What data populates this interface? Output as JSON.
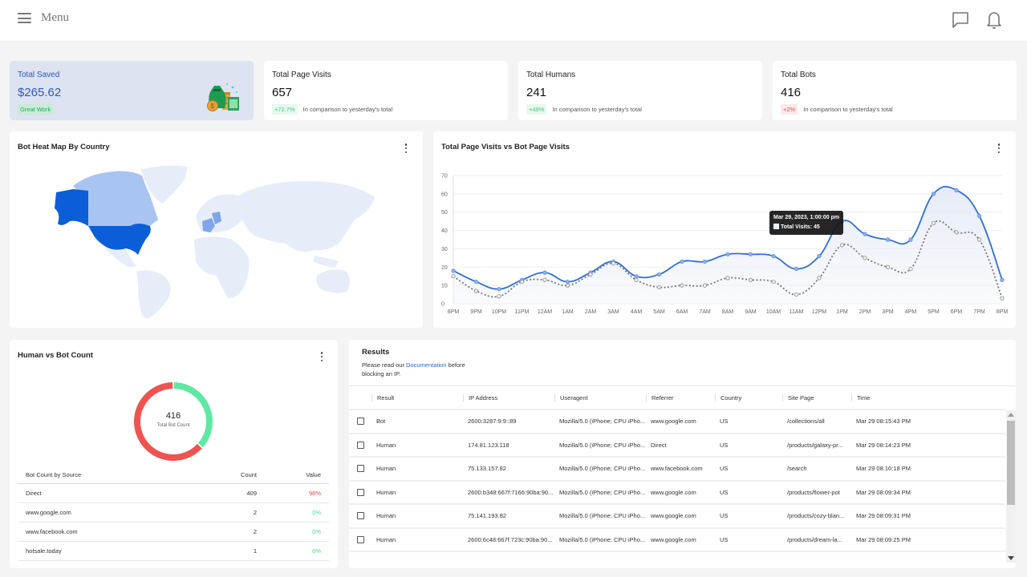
{
  "topbar": {
    "menu_label": "Menu",
    "icons": [
      "chat-icon",
      "bell-icon"
    ]
  },
  "stats": {
    "saved": {
      "title": "Total Saved",
      "value": "$265.62",
      "badge": "Great Work",
      "icon": "money-bag-icon"
    },
    "page_visits": {
      "title": "Total Page Visits",
      "value": "657",
      "change": "+72.7%",
      "note": "In comparison to yesterday's total",
      "trend": "up"
    },
    "humans": {
      "title": "Total Humans",
      "value": "241",
      "change": "+49%",
      "note": "In comparison to yesterday's total",
      "trend": "up"
    },
    "bots": {
      "title": "Total Bots",
      "value": "416",
      "change": "+2%",
      "note": "In comparison to yesterday's total",
      "trend": "bad"
    }
  },
  "heatmap": {
    "title": "Bot Heat Map By Country",
    "highlighted": [
      {
        "country": "United States",
        "level": "high",
        "color": "#0b5ed7"
      },
      {
        "country": "Canada",
        "level": "low",
        "color": "#a8c4f0"
      },
      {
        "country": "France",
        "level": "medium",
        "color": "#7fa6ea"
      },
      {
        "country": "Germany",
        "level": "medium",
        "color": "#7fa6ea"
      }
    ],
    "base_color": "#e6edf9"
  },
  "visits_chart": {
    "title": "Total Page Visits vs Bot Page Visits",
    "tooltip": {
      "title": "Mar 29, 2023, 1:00:00 pm",
      "label": "Total Visits: 45"
    }
  },
  "chart_data": {
    "type": "line",
    "title": "Total Page Visits vs Bot Page Visits",
    "xlabel": "",
    "ylabel": "",
    "ylim": [
      0,
      70
    ],
    "yticks": [
      0,
      10,
      20,
      30,
      40,
      50,
      60,
      70
    ],
    "grid": true,
    "categories": [
      "8PM",
      "9PM",
      "10PM",
      "11PM",
      "12AM",
      "1AM",
      "2AM",
      "3AM",
      "4AM",
      "5AM",
      "6AM",
      "7AM",
      "8AM",
      "9AM",
      "10AM",
      "11AM",
      "12PM",
      "1PM",
      "2PM",
      "3PM",
      "4PM",
      "5PM",
      "6PM",
      "7PM",
      "8PM"
    ],
    "series": [
      {
        "name": "Total Visits",
        "style": "solid",
        "color": "#2f6fd8",
        "values": [
          18,
          12,
          8,
          13,
          17,
          12,
          17,
          23,
          15,
          16,
          23,
          23,
          27,
          27,
          26,
          19,
          26,
          45,
          38,
          35,
          35,
          60,
          62,
          48,
          13
        ]
      },
      {
        "name": "Bot Visits",
        "style": "dotted",
        "color": "#777777",
        "values": [
          15,
          7,
          4,
          12,
          13,
          10,
          16,
          22,
          13,
          9,
          10,
          10,
          14,
          13,
          12,
          5,
          14,
          32,
          25,
          20,
          19,
          44,
          39,
          35,
          3
        ]
      }
    ]
  },
  "donut": {
    "title": "Human vs Bot Count",
    "center_value": "416",
    "center_label": "Total Bot Count",
    "segments": [
      {
        "name": "Humans",
        "value": 241,
        "color": "#5fe8a4"
      },
      {
        "name": "Bots",
        "value": 416,
        "color": "#ef5350"
      }
    ]
  },
  "source_table": {
    "headers": [
      "Bot Count by Source",
      "Count",
      "Value"
    ],
    "rows": [
      {
        "source": "Direct",
        "count": "409",
        "value": "98%",
        "tone": "red"
      },
      {
        "source": "www.google.com",
        "count": "2",
        "value": "0%",
        "tone": "green"
      },
      {
        "source": "www.facebook.com",
        "count": "2",
        "value": "0%",
        "tone": "green"
      },
      {
        "source": "hotsale.today",
        "count": "1",
        "value": "0%",
        "tone": "green"
      }
    ]
  },
  "results": {
    "title": "Results",
    "note_before": "Please read our ",
    "note_link": "Documentation",
    "note_after": " before blocking an IP.",
    "headers": [
      "Result",
      "IP Address",
      "Useragent",
      "Referrer",
      "Country",
      "Site Page",
      "Time"
    ],
    "rows": [
      {
        "result": "Bot",
        "ip": "2600:3287:9:9::89",
        "ua": "Mozilla/5.0 (iPhone; CPU iPho...",
        "ref": "www.google.com",
        "country": "US",
        "page": "/collections/all",
        "time": "Mar 29 08:15:43 PM"
      },
      {
        "result": "Human",
        "ip": "174.81.123.118",
        "ua": "Mozilla/5.0 (iPhone; CPU iPho...",
        "ref": "Direct",
        "country": "US",
        "page": "/products/galaxy-pr...",
        "time": "Mar 29 08:14:23 PM"
      },
      {
        "result": "Human",
        "ip": "75.133.157.82",
        "ua": "Mozilla/5.0 (iPhone; CPU iPho...",
        "ref": "www.facebook.com",
        "country": "US",
        "page": "/search",
        "time": "Mar 29 08:10:18 PM"
      },
      {
        "result": "Human",
        "ip": "2600:b348:667f:7166:90ba:90...",
        "ua": "Mozilla/5.0 (iPhone; CPU iPho...",
        "ref": "www.google.com",
        "country": "US",
        "page": "/products/flower-pot",
        "time": "Mar 29 08:09:34 PM"
      },
      {
        "result": "Human",
        "ip": "75.141.193.82",
        "ua": "Mozilla/5.0 (iPhone; CPU iPho...",
        "ref": "www.google.com",
        "country": "US",
        "page": "/products/cozy-blan...",
        "time": "Mar 29 08:09:31 PM"
      },
      {
        "result": "Human",
        "ip": "2600:6c48:667f:723c:90ba:90...",
        "ua": "Mozilla/5.0 (iPhone; CPU iPho...",
        "ref": "www.google.com",
        "country": "US",
        "page": "/products/dream-la...",
        "time": "Mar 29 08:09:25 PM"
      }
    ]
  }
}
